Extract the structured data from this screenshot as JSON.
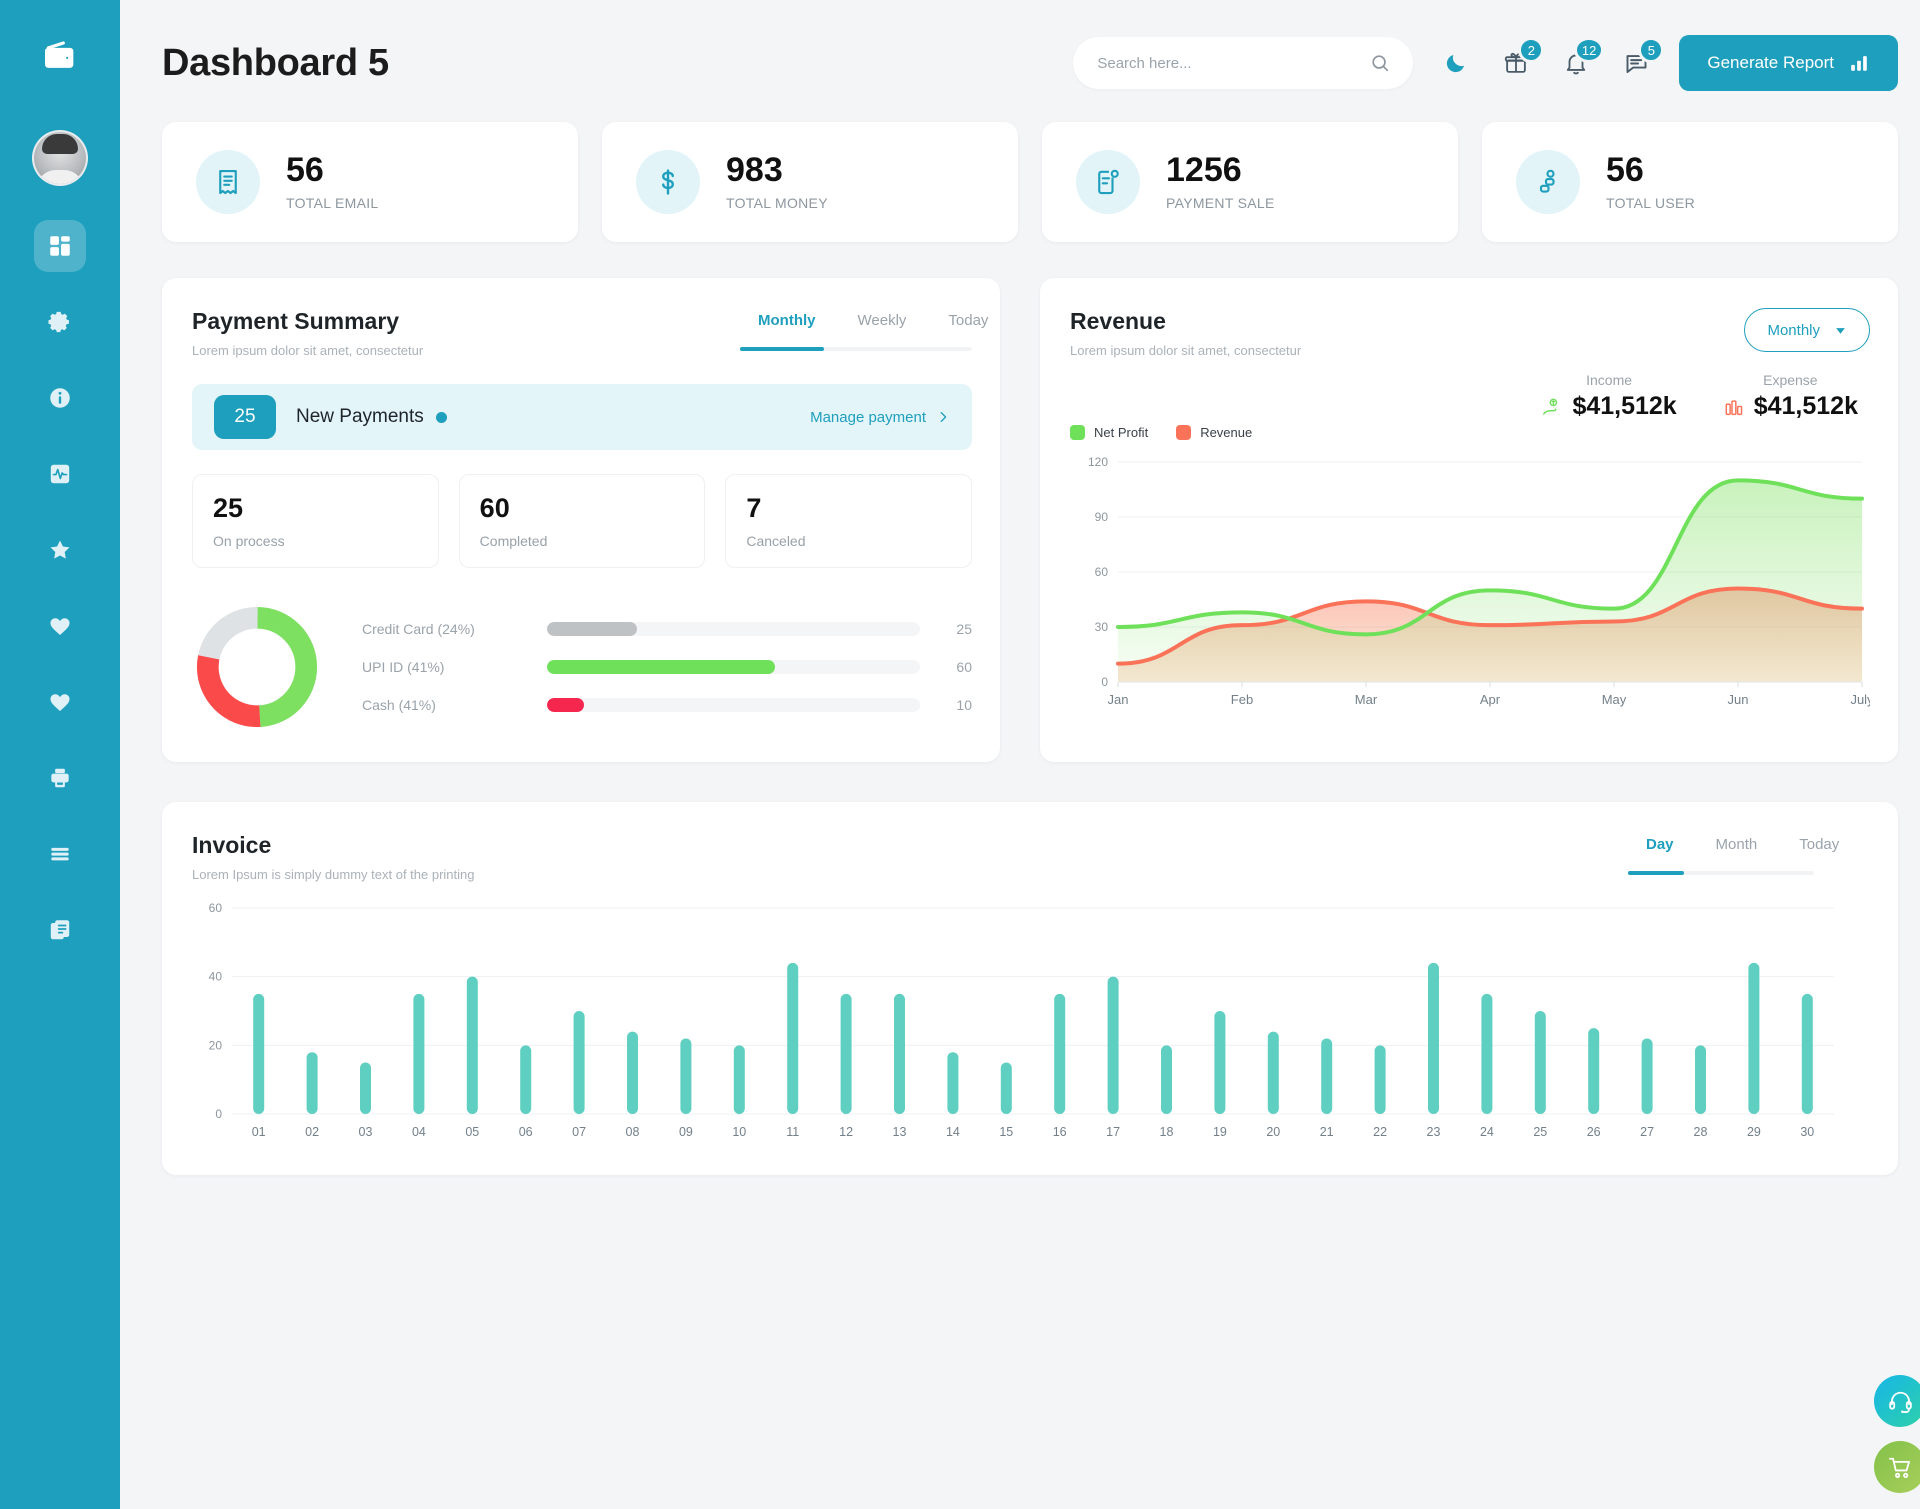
{
  "brand": {
    "logo_icon": "wallet-icon",
    "accent": "#1e9fbd"
  },
  "sidebar": {
    "items": [
      {
        "icon": "dashboard-grid-icon",
        "active": true
      },
      {
        "icon": "gear-icon",
        "active": false
      },
      {
        "icon": "info-circle-icon",
        "active": false
      },
      {
        "icon": "activity-pulse-icon",
        "active": false
      },
      {
        "icon": "star-icon",
        "active": false
      },
      {
        "icon": "heart-icon",
        "active": false
      },
      {
        "icon": "heart-outline-icon",
        "active": false
      },
      {
        "icon": "printer-icon",
        "active": false
      },
      {
        "icon": "menu-lines-icon",
        "active": false
      },
      {
        "icon": "documents-icon",
        "active": false
      }
    ]
  },
  "header": {
    "title": "Dashboard 5",
    "search": {
      "placeholder": "Search here...",
      "value": "",
      "icon": "search-icon"
    },
    "dark_mode_icon": "moon-icon",
    "gift": {
      "icon": "gift-icon",
      "badge": "2"
    },
    "bell": {
      "icon": "bell-icon",
      "badge": "12"
    },
    "chat": {
      "icon": "chat-icon",
      "badge": "5"
    },
    "generate_report": {
      "label": "Generate Report",
      "icon": "bar-chart-icon"
    }
  },
  "stats": [
    {
      "value": "56",
      "label": "TOTAL EMAIL",
      "icon": "receipt-icon"
    },
    {
      "value": "983",
      "label": "TOTAL MONEY",
      "icon": "dollar-icon"
    },
    {
      "value": "1256",
      "label": "PAYMENT SALE",
      "icon": "document-badge-icon"
    },
    {
      "value": "56",
      "label": "TOTAL USER",
      "icon": "users-icon"
    }
  ],
  "payment_summary": {
    "title": "Payment Summary",
    "subtitle": "Lorem ipsum dolor sit amet, consectetur",
    "tabs": [
      {
        "label": "Monthly",
        "active": true
      },
      {
        "label": "Weekly",
        "active": false
      },
      {
        "label": "Today",
        "active": false
      }
    ],
    "new_payments": {
      "count": "25",
      "label": "New Payments",
      "action_label": "Manage payment",
      "chevron_icon": "chevron-right-icon"
    },
    "mini_cards": [
      {
        "value": "25",
        "label": "On process"
      },
      {
        "value": "60",
        "label": "Completed"
      },
      {
        "value": "7",
        "label": "Canceled"
      }
    ],
    "methods": [
      {
        "label": "Credit Card (24%)",
        "value": "25",
        "pct": 24,
        "color": "#bfc2c5"
      },
      {
        "label": "UPI ID (41%)",
        "value": "60",
        "pct": 61,
        "color": "#6fe05a"
      },
      {
        "label": "Cash (41%)",
        "value": "10",
        "pct": 10,
        "color": "#f5274e"
      }
    ],
    "donut": {
      "segments": [
        {
          "name": "UPI ID",
          "pct": 49,
          "color": "#7ee061"
        },
        {
          "name": "Cash",
          "pct": 29,
          "color": "#fb4a4a"
        },
        {
          "name": "Credit Card",
          "pct": 22,
          "color": "#dfe2e4"
        }
      ]
    }
  },
  "revenue": {
    "title": "Revenue",
    "subtitle": "Lorem ipsum dolor sit amet, consectetur",
    "dropdown": {
      "label": "Monthly",
      "icon": "chevron-down-icon"
    },
    "income": {
      "label": "Income",
      "value": "$41,512k",
      "icon": "money-hand-icon",
      "color": "#6fe05a"
    },
    "expense": {
      "label": "Expense",
      "value": "$41,512k",
      "icon": "money-stack-icon",
      "color": "#fa7258"
    },
    "chart_data": {
      "type": "area",
      "title": "Revenue",
      "categories": [
        "Jan",
        "Feb",
        "Mar",
        "Apr",
        "May",
        "Jun",
        "July"
      ],
      "series": [
        {
          "name": "Net Profit",
          "color": "#6fe05a",
          "values": [
            30,
            38,
            26,
            50,
            40,
            110,
            100
          ]
        },
        {
          "name": "Revenue",
          "color": "#fa7258",
          "values": [
            10,
            31,
            44,
            31,
            33,
            51,
            40
          ]
        }
      ],
      "xlabel": "",
      "ylabel": "",
      "yticks": [
        0,
        30,
        60,
        90,
        120
      ],
      "ylim": [
        0,
        120
      ],
      "grid": true,
      "legend_position": "top-left"
    }
  },
  "invoice": {
    "title": "Invoice",
    "subtitle": "Lorem Ipsum is simply dummy text of the printing",
    "tabs": [
      {
        "label": "Day",
        "active": true
      },
      {
        "label": "Month",
        "active": false
      },
      {
        "label": "Today",
        "active": false
      }
    ],
    "chart_data": {
      "type": "bar",
      "title": "Invoice",
      "categories": [
        "01",
        "02",
        "03",
        "04",
        "05",
        "06",
        "07",
        "08",
        "09",
        "10",
        "11",
        "12",
        "13",
        "14",
        "15",
        "16",
        "17",
        "18",
        "19",
        "20",
        "21",
        "22",
        "23",
        "24",
        "25",
        "26",
        "27",
        "28",
        "29",
        "30"
      ],
      "values": [
        35,
        18,
        15,
        35,
        40,
        20,
        30,
        24,
        22,
        20,
        44,
        35,
        35,
        18,
        15,
        35,
        40,
        20,
        30,
        24,
        22,
        20,
        44,
        35,
        30,
        25,
        22,
        20,
        44,
        35
      ],
      "color": "#5ecfc0",
      "xlabel": "",
      "ylabel": "",
      "yticks": [
        0,
        20,
        40,
        60
      ],
      "ylim": [
        0,
        60
      ],
      "grid": true
    }
  },
  "fabs": [
    {
      "icon": "headset-support-icon"
    },
    {
      "icon": "shopping-cart-icon"
    }
  ]
}
